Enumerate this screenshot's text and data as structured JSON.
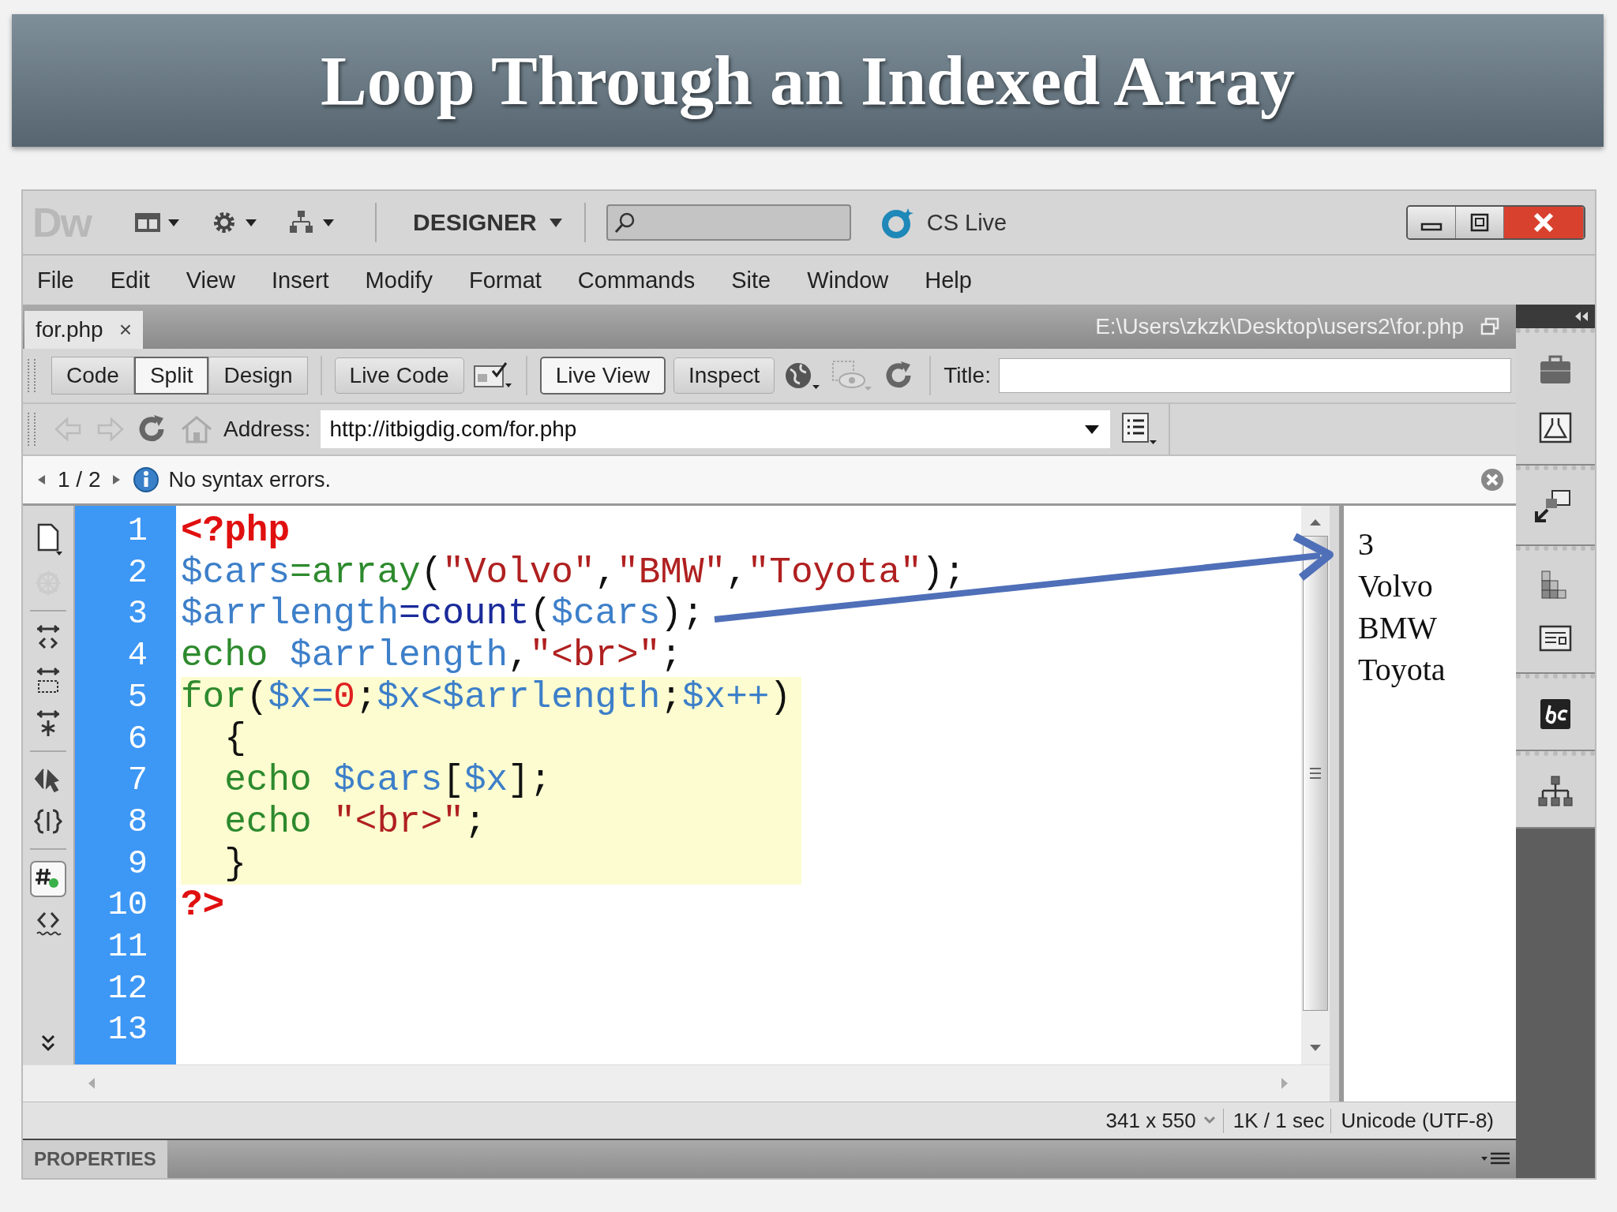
{
  "slide_title": "Loop Through an Indexed Array",
  "app": {
    "logo": "Dw",
    "workspace": "DESIGNER",
    "cs_live": "CS Live"
  },
  "menu": [
    "File",
    "Edit",
    "View",
    "Insert",
    "Modify",
    "Format",
    "Commands",
    "Site",
    "Window",
    "Help"
  ],
  "document": {
    "tab": "for.php",
    "close": "×",
    "path": "E:\\Users\\zkzk\\Desktop\\users2\\for.php"
  },
  "view_buttons": [
    {
      "label": "Code",
      "selected": false
    },
    {
      "label": "Split",
      "selected": true
    },
    {
      "label": "Design",
      "selected": false
    }
  ],
  "live_buttons": [
    {
      "label": "Live Code",
      "selected": false
    },
    {
      "label": "Live View",
      "selected": true
    },
    {
      "label": "Inspect",
      "selected": false
    }
  ],
  "title_label": "Title:",
  "address": {
    "label": "Address:",
    "value": "http://itbigdig.com/for.php"
  },
  "info": {
    "pager": "1 / 2",
    "message": "No syntax errors."
  },
  "code_lines": [
    {
      "number": "1",
      "highlighted": false,
      "tokens": [
        {
          "text": "<?php",
          "kind": "delim"
        }
      ]
    },
    {
      "number": "2",
      "highlighted": false,
      "tokens": [
        {
          "text": "$cars",
          "kind": "variable"
        },
        {
          "text": "=array",
          "kind": "keyword"
        },
        {
          "text": "(",
          "kind": "plain"
        },
        {
          "text": "\"Volvo\"",
          "kind": "string"
        },
        {
          "text": ",",
          "kind": "plain"
        },
        {
          "text": "\"BMW\"",
          "kind": "string"
        },
        {
          "text": ",",
          "kind": "plain"
        },
        {
          "text": "\"Toyota\"",
          "kind": "string"
        },
        {
          "text": ");",
          "kind": "plain"
        }
      ]
    },
    {
      "number": "3",
      "highlighted": false,
      "tokens": [
        {
          "text": "$arrlength",
          "kind": "variable"
        },
        {
          "text": "=count",
          "kind": "builtin"
        },
        {
          "text": "(",
          "kind": "plain"
        },
        {
          "text": "$cars",
          "kind": "variable"
        },
        {
          "text": ");",
          "kind": "plain"
        }
      ]
    },
    {
      "number": "4",
      "highlighted": false,
      "tokens": [
        {
          "text": "echo ",
          "kind": "keyword"
        },
        {
          "text": "$arrlength",
          "kind": "variable"
        },
        {
          "text": ",",
          "kind": "plain"
        },
        {
          "text": "\"<br>\"",
          "kind": "string"
        },
        {
          "text": ";",
          "kind": "plain"
        }
      ]
    },
    {
      "number": "5",
      "highlighted": true,
      "tokens": [
        {
          "text": "for",
          "kind": "keyword"
        },
        {
          "text": "(",
          "kind": "plain"
        },
        {
          "text": "$x=",
          "kind": "variable"
        },
        {
          "text": "0",
          "kind": "number"
        },
        {
          "text": ";",
          "kind": "plain"
        },
        {
          "text": "$x<$arrlength",
          "kind": "variable"
        },
        {
          "text": ";",
          "kind": "plain"
        },
        {
          "text": "$x++",
          "kind": "variable"
        },
        {
          "text": ")",
          "kind": "plain"
        }
      ]
    },
    {
      "number": "6",
      "highlighted": true,
      "tokens": [
        {
          "text": "  {",
          "kind": "plain"
        }
      ]
    },
    {
      "number": "7",
      "highlighted": true,
      "tokens": [
        {
          "text": "  echo ",
          "kind": "keyword"
        },
        {
          "text": "$cars",
          "kind": "variable"
        },
        {
          "text": "[",
          "kind": "plain"
        },
        {
          "text": "$x",
          "kind": "variable"
        },
        {
          "text": "];",
          "kind": "plain"
        }
      ]
    },
    {
      "number": "8",
      "highlighted": true,
      "tokens": [
        {
          "text": "  echo ",
          "kind": "keyword"
        },
        {
          "text": "\"<br>\"",
          "kind": "string"
        },
        {
          "text": ";",
          "kind": "plain"
        }
      ]
    },
    {
      "number": "9",
      "highlighted": true,
      "tokens": [
        {
          "text": "  }",
          "kind": "plain"
        }
      ]
    },
    {
      "number": "10",
      "highlighted": false,
      "tokens": [
        {
          "text": "?>",
          "kind": "delim"
        }
      ]
    },
    {
      "number": "11",
      "highlighted": false
    },
    {
      "number": "12",
      "highlighted": false
    },
    {
      "number": "13",
      "highlighted": false
    }
  ],
  "preview": [
    "3",
    "Volvo",
    "BMW",
    "Toyota"
  ],
  "status": [
    "341 x 550",
    "1K / 1 sec",
    "Unicode (UTF-8)"
  ],
  "properties": "PROPERTIES"
}
